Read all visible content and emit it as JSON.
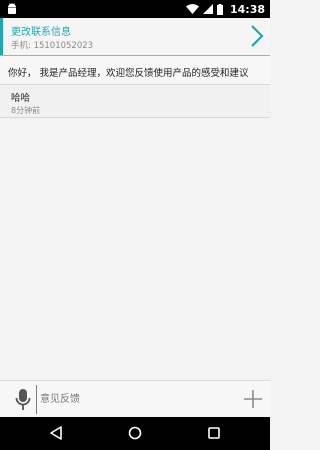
{
  "status_bar": {
    "time": "14:38",
    "icons": [
      "android-icon",
      "wifi-icon",
      "signal-icon",
      "battery-icon"
    ]
  },
  "header": {
    "title": "更改联系信息",
    "phone": "手机: 15101052023",
    "icon": "chevron-right-icon",
    "accent_color": "#1ea8b2"
  },
  "welcome": {
    "text": "你好， 我是产品经理，欢迎您反馈使用产品的感受和建议"
  },
  "messages": [
    {
      "text": "哈哈",
      "time": "8分钟前"
    }
  ],
  "input_bar": {
    "mic_icon": "microphone-icon",
    "placeholder": "意见反馈",
    "value": "",
    "add_icon": "plus-icon"
  },
  "nav_bar": {
    "icons": [
      "back-icon",
      "home-icon",
      "recents-icon"
    ]
  }
}
